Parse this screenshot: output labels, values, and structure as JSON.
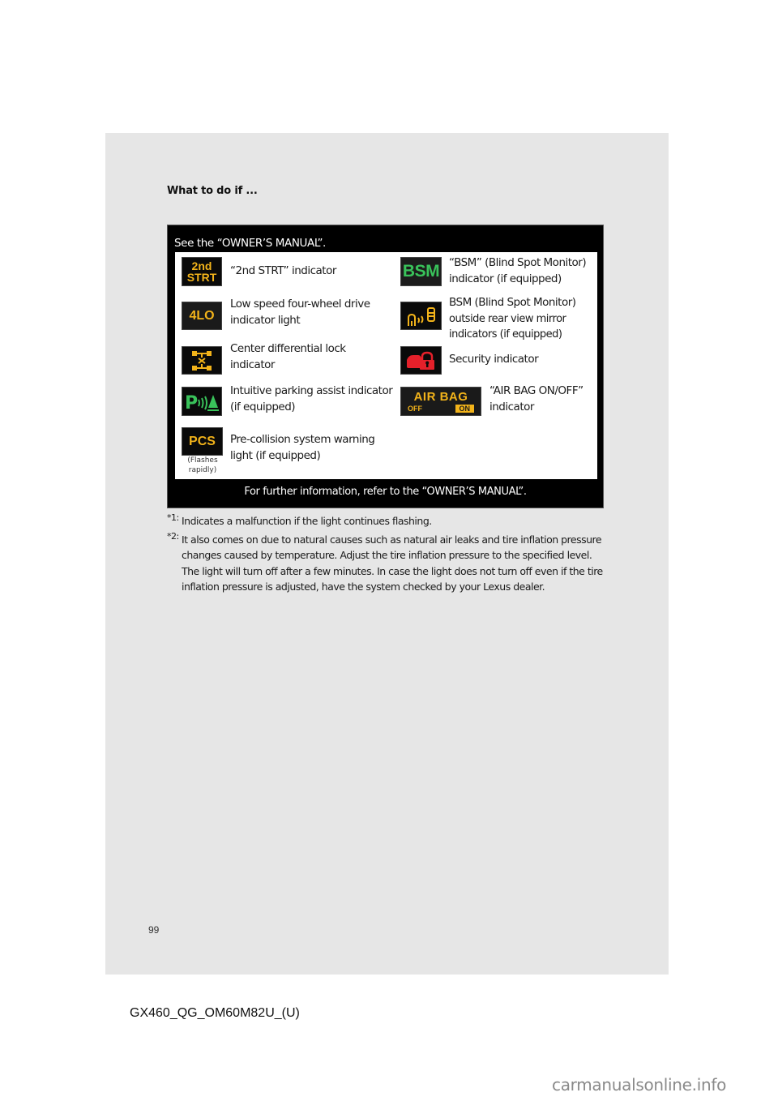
{
  "section_title": "What to do if ...",
  "panel": {
    "heading": "See the “OWNER’S MANUAL”.",
    "footer": "For further information, refer to the “OWNER’S MANUAL”.",
    "entries": [
      {
        "icon": "2nd-strt-indicator-icon",
        "icon_text_line1": "2nd",
        "icon_text_line2": "STRT",
        "icon_color": "#f2b31a",
        "lines": [
          "“2nd STRT” indicator"
        ]
      },
      {
        "icon": "bsm-indicator-icon",
        "icon_text": "BSM",
        "icon_color": "#39c25a",
        "lines": [
          "“BSM” (Blind Spot Monitor)",
          "indicator (if equipped)"
        ]
      },
      {
        "icon": "4lo-indicator-icon",
        "icon_text": "4LO",
        "icon_color": "#f2b31a",
        "lines": [
          "Low speed four-wheel drive",
          "indicator light"
        ]
      },
      {
        "icon": "bsm-mirror-indicator-icon",
        "icon_color": "#f2b31a",
        "lines": [
          "BSM (Blind Spot Monitor)",
          "outside rear view mirror",
          "indicators (if equipped)"
        ]
      },
      {
        "icon": "center-differential-lock-icon",
        "icon_color": "#f2b31a",
        "lines": [
          "Center differential lock",
          "indicator"
        ]
      },
      {
        "icon": "security-indicator-icon",
        "icon_color": "#e4202a",
        "lines": [
          "Security indicator"
        ]
      },
      {
        "icon": "parking-assist-indicator-icon",
        "icon_color": "#39c25a",
        "lines": [
          "Intuitive parking assist indicator",
          "(if equipped)"
        ]
      },
      {
        "icon": "air-bag-on-off-indicator-icon",
        "icon_text_line1": "AIR BAG",
        "icon_text_off": "OFF",
        "icon_text_on": "ON",
        "icon_color": "#f2b31a",
        "lines": [
          "“AIR BAG ON/OFF”",
          "indicator"
        ]
      },
      {
        "icon": "pcs-warning-icon",
        "icon_text": "PCS",
        "icon_color": "#f2b31a",
        "note_line1": "(Flashes",
        "note_line2": "rapidly)",
        "lines": [
          "Pre-collision system warning",
          "light (if equipped)"
        ]
      }
    ]
  },
  "footnotes": [
    {
      "mark": "*1:",
      "text": "Indicates a malfunction if the light continues flashing."
    },
    {
      "mark": "*2:",
      "text": "It also comes on due to natural causes such as natural air leaks and tire inflation pressure changes caused by temperature. Adjust the tire inflation pressure to the specified level. The light will turn off after a few minutes. In case the light does not turn off even if the tire inflation pressure is adjusted, have the system checked by your Lexus dealer."
    }
  ],
  "page_number": "99",
  "doc_code": "GX460_QG_OM60M82U_(U)",
  "watermark": "carmanualsonline.info"
}
